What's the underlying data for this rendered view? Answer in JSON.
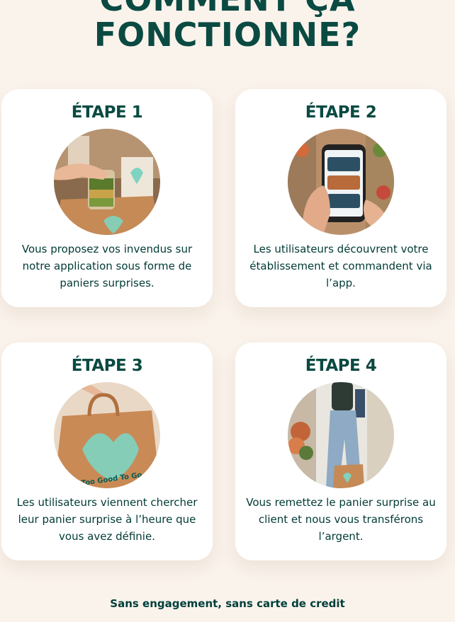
{
  "section": {
    "title_line1": "COMMENT ÇA",
    "title_line2": "FONCTIONNE?"
  },
  "steps": [
    {
      "title": "ÉTAPE 1",
      "description": "Vous proposez vos invendus sur notre application sous forme de paniers surprises."
    },
    {
      "title": "ÉTAPE 2",
      "description": "Les utilisateurs découvrent votre établissement et commandent via l’app."
    },
    {
      "title": "ÉTAPE 3",
      "description": "Les utilisateurs viennent chercher leur panier surprise à l’heure que vous avez définie.",
      "bag_text": "Too Good To Go"
    },
    {
      "title": "ÉTAPE 4",
      "description": "Vous remettez le panier surprise au client et nous vous transférons l’argent."
    }
  ],
  "footer": {
    "note": "Sans engagement, sans carte de credit"
  },
  "colors": {
    "page_background": "#faf3ec",
    "brand_dark_green": "#0a4a42",
    "card_background": "#ffffff",
    "brand_mint": "#7fd3c0",
    "kraft_bag": "#c58a55"
  }
}
